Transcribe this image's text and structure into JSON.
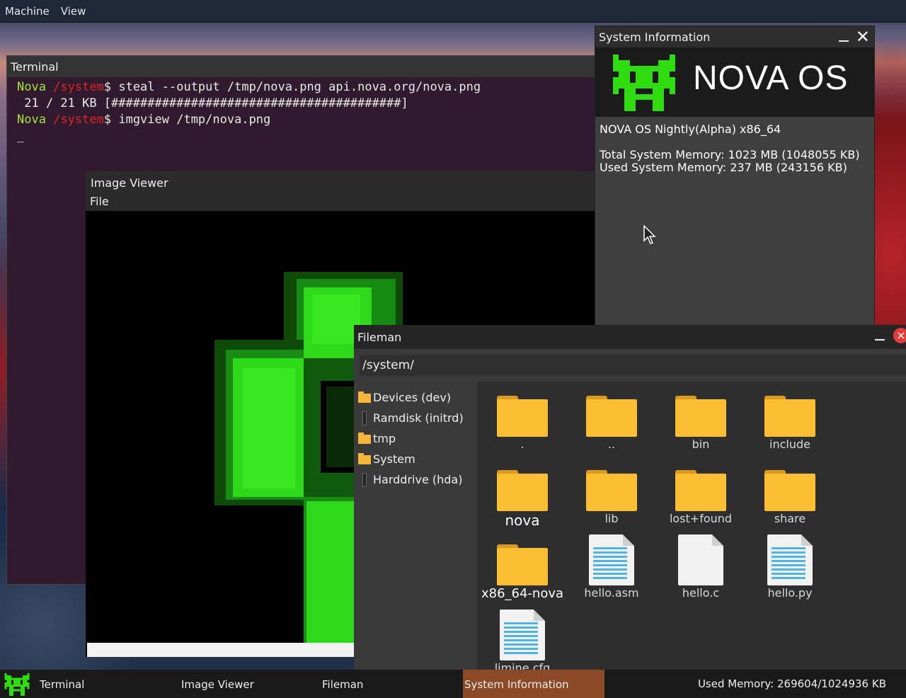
{
  "menubar": {
    "items": [
      "Machine",
      "View"
    ]
  },
  "terminal": {
    "title": "Terminal",
    "user": "Nova",
    "path": "/system",
    "prompt_symbol": "$",
    "cmd1": " steal --output /tmp/nova.png api.nova.org/nova.png",
    "progress": " 21 / 21 KB [########################################]",
    "cmd2": " imgview /tmp/nova.png",
    "cursor": "_"
  },
  "image_viewer": {
    "title": "Image Viewer",
    "menu_file": "File"
  },
  "sysinfo": {
    "title": "System Information",
    "os_name": "NOVA OS",
    "version": "NOVA OS Nightly(Alpha) x86_64",
    "total_memory": "Total System Memory: 1023 MB (1048055 KB)",
    "used_memory": "Used System Memory: 237 MB (243156 KB)"
  },
  "fileman": {
    "title": "Fileman",
    "path": "/system/",
    "close_glyph": "×",
    "sidebar": [
      {
        "label": "Devices (dev)",
        "icon": "folder-icon"
      },
      {
        "label": "Ramdisk (initrd)",
        "icon": "drive-icon"
      },
      {
        "label": "tmp",
        "icon": "folder-icon"
      },
      {
        "label": "System",
        "icon": "folder-icon"
      },
      {
        "label": "Harddrive (hda)",
        "icon": "drive-icon"
      }
    ],
    "items": [
      {
        "label": ".",
        "type": "folder"
      },
      {
        "label": "..",
        "type": "folder"
      },
      {
        "label": "bin",
        "type": "folder"
      },
      {
        "label": "include",
        "type": "folder"
      },
      {
        "label": "nova",
        "type": "folder"
      },
      {
        "label": "lib",
        "type": "folder"
      },
      {
        "label": "lost+found",
        "type": "folder"
      },
      {
        "label": "share",
        "type": "folder"
      },
      {
        "label": "x86_64-nova",
        "type": "folder"
      },
      {
        "label": "hello.asm",
        "type": "text-file"
      },
      {
        "label": "hello.c",
        "type": "blank-file"
      },
      {
        "label": "hello.py",
        "type": "text-file"
      },
      {
        "label": "limine.cfg",
        "type": "text-file"
      }
    ]
  },
  "taskbar": {
    "tasks": [
      "Terminal",
      "Image Viewer",
      "Fileman",
      "System Information"
    ],
    "active_task": "System Information",
    "memory": "Used Memory: 269604/1024936 KB"
  },
  "colors": {
    "accent_active_task": "#8a4a26",
    "prompt_user": "#a8e33a",
    "prompt_path": "#e02525",
    "folder": "#fbbd34",
    "logo_green": "#2fdc10"
  }
}
